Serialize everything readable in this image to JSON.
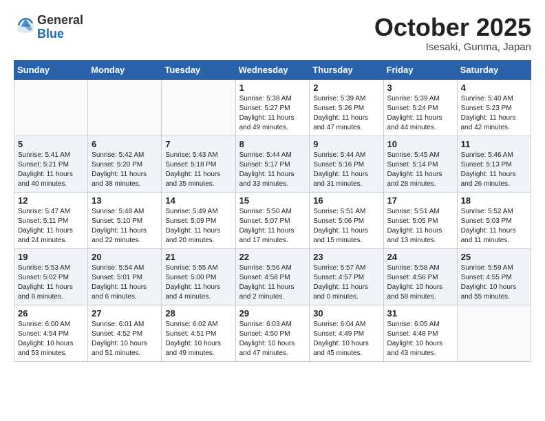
{
  "header": {
    "logo_general": "General",
    "logo_blue": "Blue",
    "month_title": "October 2025",
    "location": "Isesaki, Gunma, Japan"
  },
  "weekdays": [
    "Sunday",
    "Monday",
    "Tuesday",
    "Wednesday",
    "Thursday",
    "Friday",
    "Saturday"
  ],
  "weeks": [
    [
      {
        "day": "",
        "info": ""
      },
      {
        "day": "",
        "info": ""
      },
      {
        "day": "",
        "info": ""
      },
      {
        "day": "1",
        "info": "Sunrise: 5:38 AM\nSunset: 5:27 PM\nDaylight: 11 hours\nand 49 minutes."
      },
      {
        "day": "2",
        "info": "Sunrise: 5:39 AM\nSunset: 5:26 PM\nDaylight: 11 hours\nand 47 minutes."
      },
      {
        "day": "3",
        "info": "Sunrise: 5:39 AM\nSunset: 5:24 PM\nDaylight: 11 hours\nand 44 minutes."
      },
      {
        "day": "4",
        "info": "Sunrise: 5:40 AM\nSunset: 5:23 PM\nDaylight: 11 hours\nand 42 minutes."
      }
    ],
    [
      {
        "day": "5",
        "info": "Sunrise: 5:41 AM\nSunset: 5:21 PM\nDaylight: 11 hours\nand 40 minutes."
      },
      {
        "day": "6",
        "info": "Sunrise: 5:42 AM\nSunset: 5:20 PM\nDaylight: 11 hours\nand 38 minutes."
      },
      {
        "day": "7",
        "info": "Sunrise: 5:43 AM\nSunset: 5:18 PM\nDaylight: 11 hours\nand 35 minutes."
      },
      {
        "day": "8",
        "info": "Sunrise: 5:44 AM\nSunset: 5:17 PM\nDaylight: 11 hours\nand 33 minutes."
      },
      {
        "day": "9",
        "info": "Sunrise: 5:44 AM\nSunset: 5:16 PM\nDaylight: 11 hours\nand 31 minutes."
      },
      {
        "day": "10",
        "info": "Sunrise: 5:45 AM\nSunset: 5:14 PM\nDaylight: 11 hours\nand 28 minutes."
      },
      {
        "day": "11",
        "info": "Sunrise: 5:46 AM\nSunset: 5:13 PM\nDaylight: 11 hours\nand 26 minutes."
      }
    ],
    [
      {
        "day": "12",
        "info": "Sunrise: 5:47 AM\nSunset: 5:11 PM\nDaylight: 11 hours\nand 24 minutes."
      },
      {
        "day": "13",
        "info": "Sunrise: 5:48 AM\nSunset: 5:10 PM\nDaylight: 11 hours\nand 22 minutes."
      },
      {
        "day": "14",
        "info": "Sunrise: 5:49 AM\nSunset: 5:09 PM\nDaylight: 11 hours\nand 20 minutes."
      },
      {
        "day": "15",
        "info": "Sunrise: 5:50 AM\nSunset: 5:07 PM\nDaylight: 11 hours\nand 17 minutes."
      },
      {
        "day": "16",
        "info": "Sunrise: 5:51 AM\nSunset: 5:06 PM\nDaylight: 11 hours\nand 15 minutes."
      },
      {
        "day": "17",
        "info": "Sunrise: 5:51 AM\nSunset: 5:05 PM\nDaylight: 11 hours\nand 13 minutes."
      },
      {
        "day": "18",
        "info": "Sunrise: 5:52 AM\nSunset: 5:03 PM\nDaylight: 11 hours\nand 11 minutes."
      }
    ],
    [
      {
        "day": "19",
        "info": "Sunrise: 5:53 AM\nSunset: 5:02 PM\nDaylight: 11 hours\nand 8 minutes."
      },
      {
        "day": "20",
        "info": "Sunrise: 5:54 AM\nSunset: 5:01 PM\nDaylight: 11 hours\nand 6 minutes."
      },
      {
        "day": "21",
        "info": "Sunrise: 5:55 AM\nSunset: 5:00 PM\nDaylight: 11 hours\nand 4 minutes."
      },
      {
        "day": "22",
        "info": "Sunrise: 5:56 AM\nSunset: 4:58 PM\nDaylight: 11 hours\nand 2 minutes."
      },
      {
        "day": "23",
        "info": "Sunrise: 5:57 AM\nSunset: 4:57 PM\nDaylight: 11 hours\nand 0 minutes."
      },
      {
        "day": "24",
        "info": "Sunrise: 5:58 AM\nSunset: 4:56 PM\nDaylight: 10 hours\nand 58 minutes."
      },
      {
        "day": "25",
        "info": "Sunrise: 5:59 AM\nSunset: 4:55 PM\nDaylight: 10 hours\nand 55 minutes."
      }
    ],
    [
      {
        "day": "26",
        "info": "Sunrise: 6:00 AM\nSunset: 4:54 PM\nDaylight: 10 hours\nand 53 minutes."
      },
      {
        "day": "27",
        "info": "Sunrise: 6:01 AM\nSunset: 4:52 PM\nDaylight: 10 hours\nand 51 minutes."
      },
      {
        "day": "28",
        "info": "Sunrise: 6:02 AM\nSunset: 4:51 PM\nDaylight: 10 hours\nand 49 minutes."
      },
      {
        "day": "29",
        "info": "Sunrise: 6:03 AM\nSunset: 4:50 PM\nDaylight: 10 hours\nand 47 minutes."
      },
      {
        "day": "30",
        "info": "Sunrise: 6:04 AM\nSunset: 4:49 PM\nDaylight: 10 hours\nand 45 minutes."
      },
      {
        "day": "31",
        "info": "Sunrise: 6:05 AM\nSunset: 4:48 PM\nDaylight: 10 hours\nand 43 minutes."
      },
      {
        "day": "",
        "info": ""
      }
    ]
  ]
}
